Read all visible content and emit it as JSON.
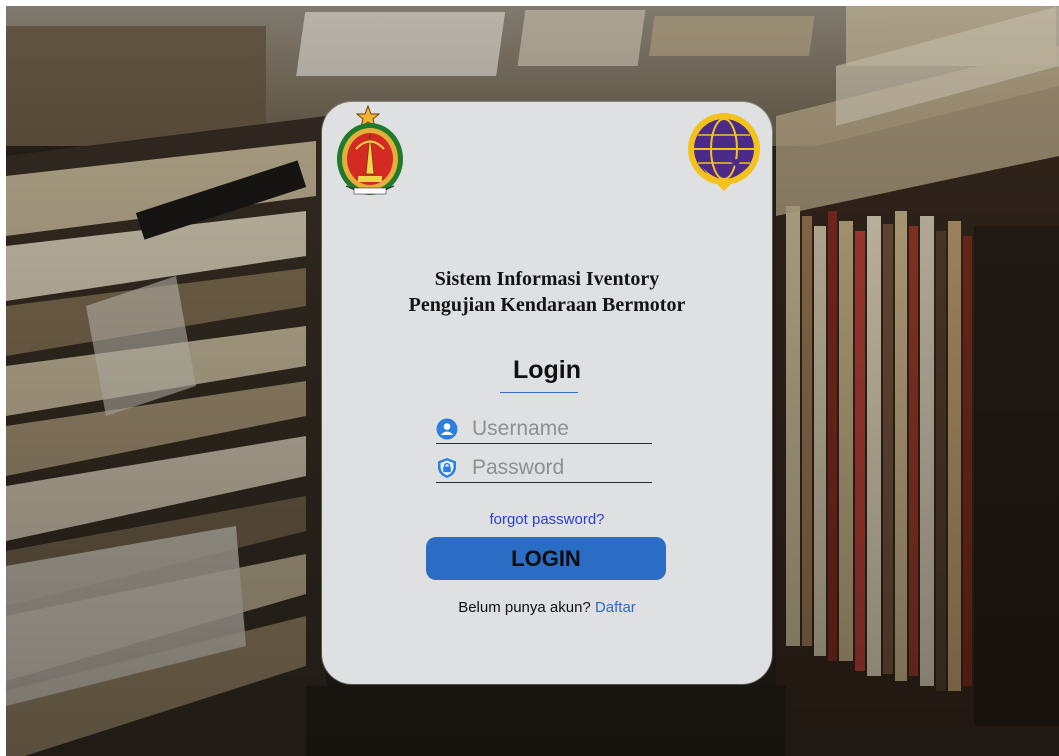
{
  "header": {
    "title_line1": "Sistem Informasi Iventory",
    "title_line2": "Pengujian Kendaraan Bermotor"
  },
  "login": {
    "heading": "Login",
    "username_placeholder": "Username",
    "password_placeholder": "Password",
    "forgot_label": "forgot password?",
    "submit_label": "LOGIN",
    "register_prompt": "Belum punya akun?",
    "register_link": "Daftar"
  },
  "icons": {
    "username": "user-icon",
    "password": "shield-lock-icon",
    "left_logo": "regional-emblem-logo",
    "right_logo": "ministry-of-transportation-logo"
  },
  "colors": {
    "card_background": "#dfe0e2",
    "button": "#2b6cc4",
    "link": "#2b3fd0",
    "underline": "#3b6fc4"
  }
}
